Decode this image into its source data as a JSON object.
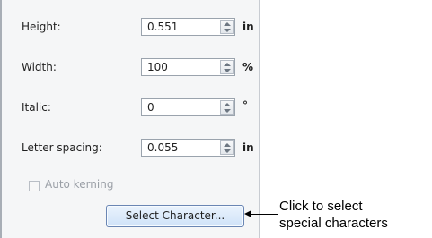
{
  "panel": {
    "rows": [
      {
        "label": "Height:",
        "value": "0.551",
        "unit": "in"
      },
      {
        "label": "Width:",
        "value": "100",
        "unit": "%"
      },
      {
        "label": "Italic:",
        "value": "0",
        "unit": "°"
      },
      {
        "label": "Letter spacing:",
        "value": "0.055",
        "unit": "in"
      }
    ],
    "auto_kerning": {
      "label": "Auto kerning",
      "checked": false,
      "enabled": false
    },
    "select_character_button": "Select Character..."
  },
  "annotation": {
    "line1": "Click to select",
    "line2": "special characters"
  }
}
